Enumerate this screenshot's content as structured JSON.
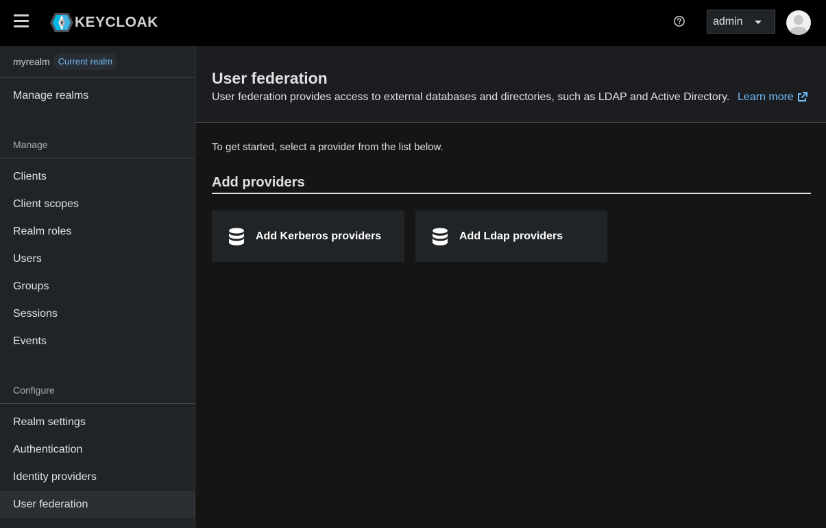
{
  "header": {
    "logo_text": "KEYCLOAK",
    "user_label": "admin"
  },
  "sidebar": {
    "realm_name": "myrealm",
    "realm_badge": "Current realm",
    "manage_realms": "Manage realms",
    "manage_section": "Manage",
    "manage_items": [
      {
        "label": "Clients"
      },
      {
        "label": "Client scopes"
      },
      {
        "label": "Realm roles"
      },
      {
        "label": "Users"
      },
      {
        "label": "Groups"
      },
      {
        "label": "Sessions"
      },
      {
        "label": "Events"
      }
    ],
    "configure_section": "Configure",
    "configure_items": [
      {
        "label": "Realm settings"
      },
      {
        "label": "Authentication"
      },
      {
        "label": "Identity providers"
      },
      {
        "label": "User federation",
        "active": true
      }
    ]
  },
  "page": {
    "title": "User federation",
    "description": "User federation provides access to external databases and directories, such as LDAP and Active Directory.",
    "learn_more": "Learn more",
    "intro": "To get started, select a provider from the list below.",
    "section_title": "Add providers",
    "providers": [
      {
        "label": "Add Kerberos providers",
        "icon": "database-icon"
      },
      {
        "label": "Add Ldap providers",
        "icon": "database-icon"
      }
    ]
  },
  "colors": {
    "link": "#73bcf7",
    "masthead": "#000000",
    "sidebar": "#212427",
    "background": "#151515"
  }
}
